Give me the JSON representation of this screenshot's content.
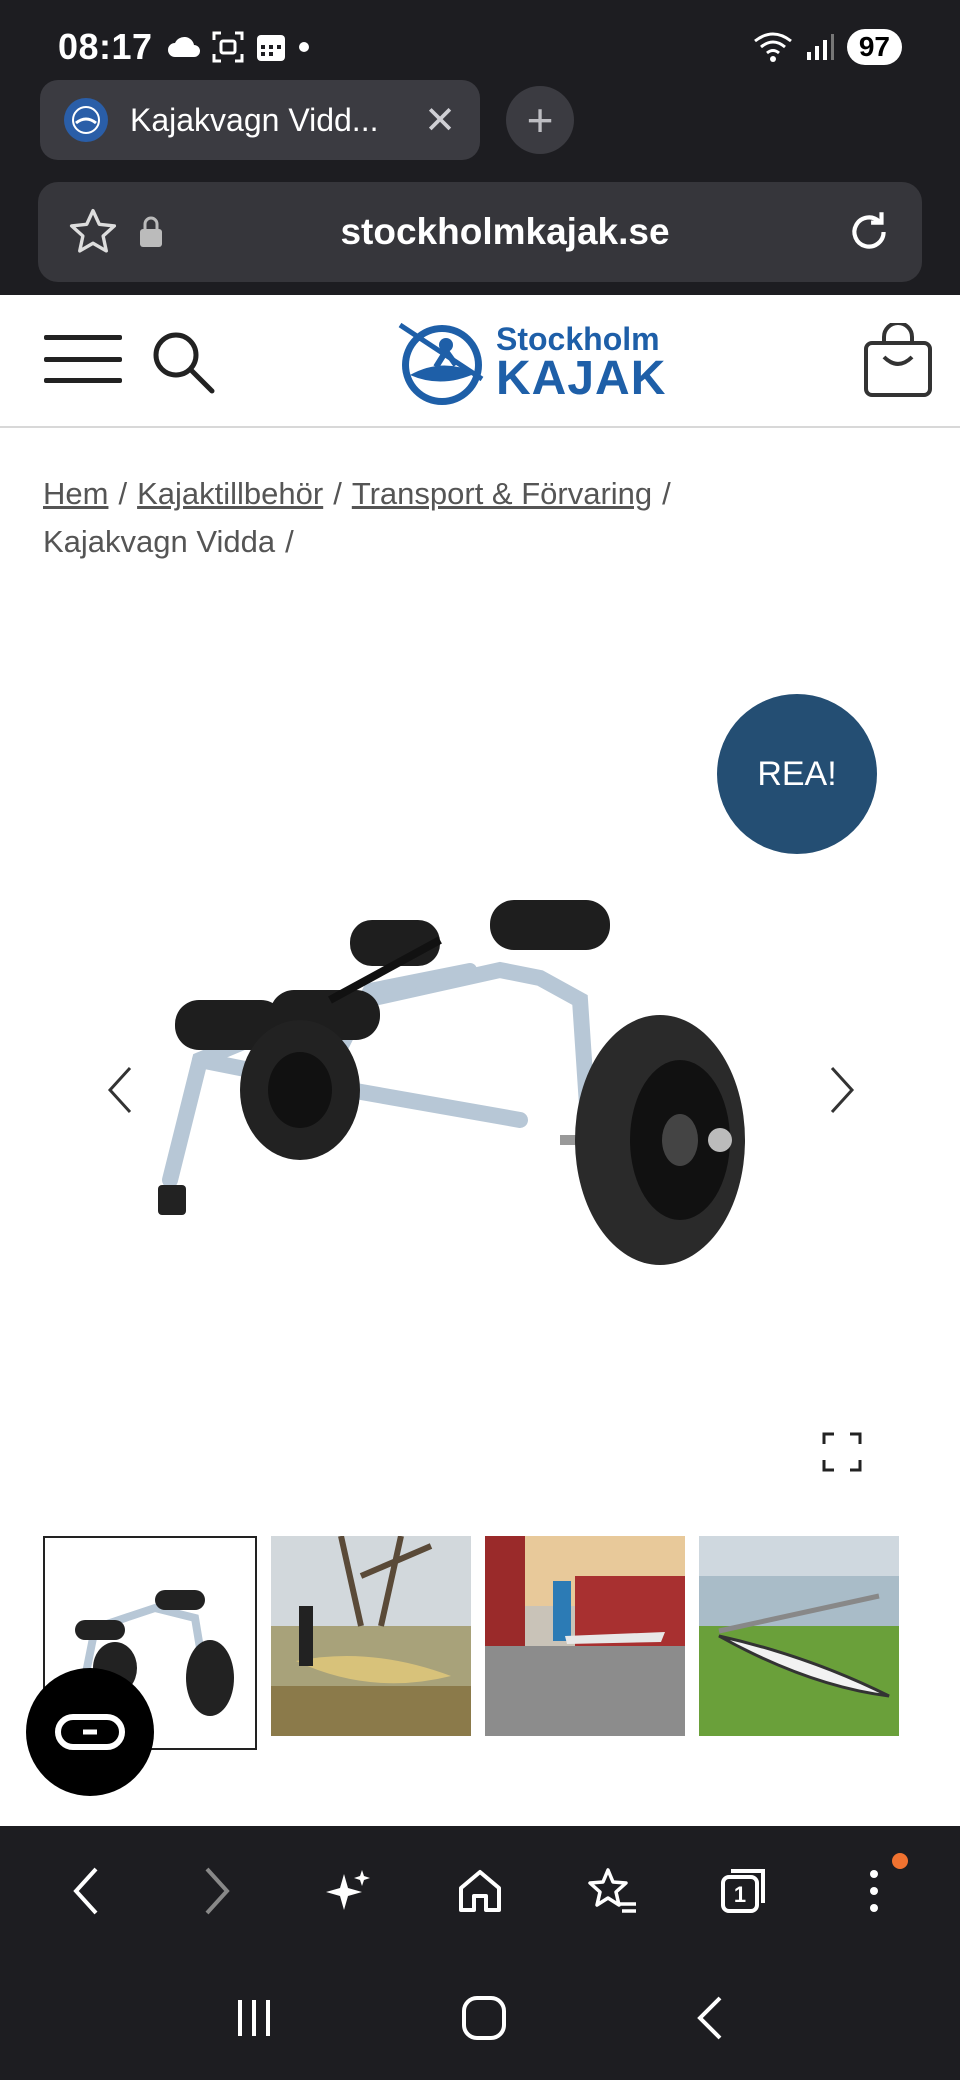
{
  "status_bar": {
    "time": "08:17",
    "battery": "97"
  },
  "browser": {
    "tab_title": "Kajakvagn Vidd...",
    "url": "stockholmkajak.se"
  },
  "site": {
    "logo_small": "Stockholm",
    "logo_big": "KAJAK"
  },
  "breadcrumb": {
    "items": [
      "Hem",
      "Kajaktillbehör",
      "Transport & Förvaring",
      "Kajakvagn Vidda"
    ],
    "separator": "/"
  },
  "product": {
    "badge": "REA!"
  },
  "colors": {
    "chrome_bg": "#1d1d21",
    "brand_blue": "#1e5fa8",
    "badge_bg": "#244e73"
  }
}
